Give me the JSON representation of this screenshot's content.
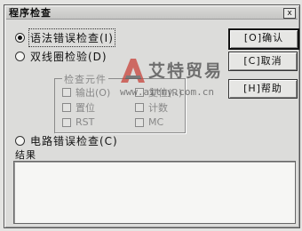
{
  "window": {
    "title": "程序检查",
    "close_glyph": "x"
  },
  "options": {
    "syntax_check": "语法错误检查(I)",
    "double_coil_check": "双线圈检验(D)",
    "circuit_check": "电路错误检查(C)"
  },
  "check_group": {
    "label": "检查元件",
    "items": [
      "输出(O)",
      "置位",
      "复位(R)",
      "计数",
      "RST",
      "MC"
    ]
  },
  "buttons": {
    "ok": "[O]确认",
    "cancel": "[C]取消",
    "help": "[H]帮助"
  },
  "result": {
    "label": "结果",
    "text": ""
  },
  "watermark": {
    "brand": "艾特贸易",
    "url": "www.aitmy.com.cn"
  },
  "state": {
    "selected_option": "syntax_check"
  }
}
